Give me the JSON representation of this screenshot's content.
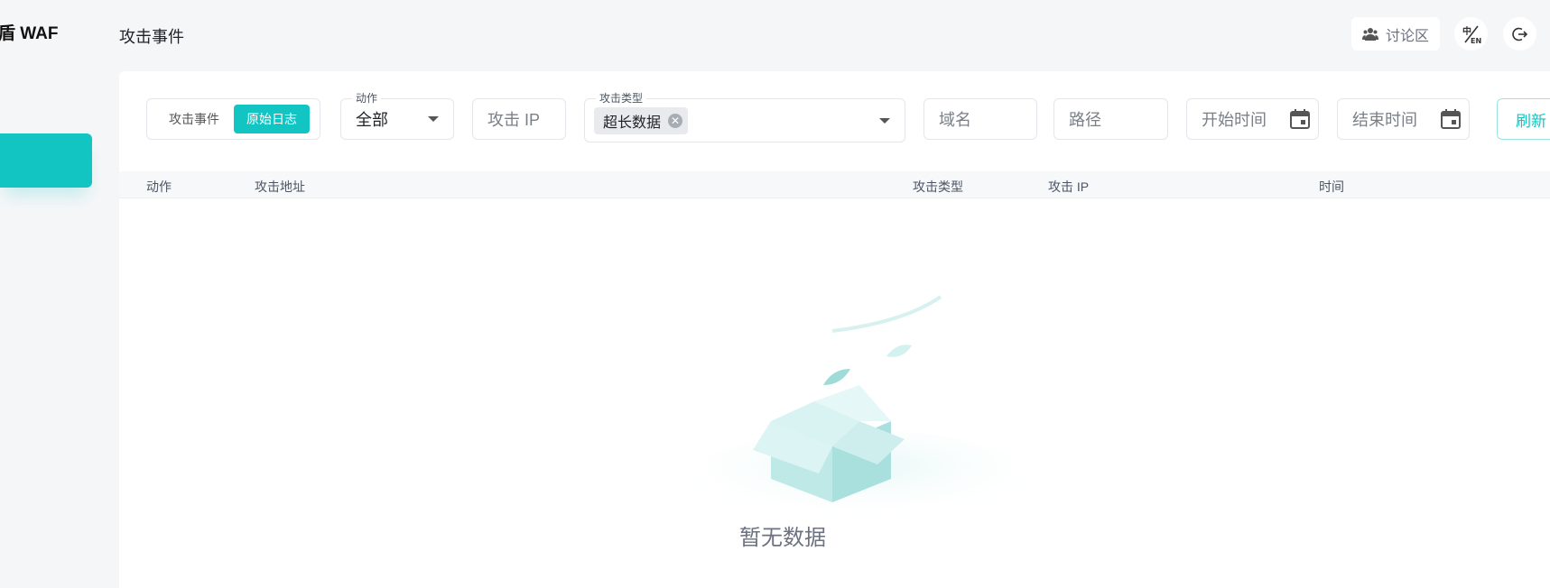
{
  "sidebar": {
    "brand": "盾 WAF"
  },
  "header": {
    "title": "攻击事件",
    "forum_label": "讨论区",
    "lang_icon": "language-toggle-icon",
    "logout_icon": "logout-icon"
  },
  "filters": {
    "mode_tabs": [
      {
        "label": "攻击事件",
        "active": false
      },
      {
        "label": "原始日志",
        "active": true
      }
    ],
    "action": {
      "label": "动作",
      "value": "全部"
    },
    "attack_ip": {
      "placeholder": "攻击 IP"
    },
    "attack_type": {
      "label": "攻击类型",
      "chips": [
        "超长数据"
      ]
    },
    "domain": {
      "placeholder": "域名"
    },
    "path": {
      "placeholder": "路径"
    },
    "start_time": {
      "placeholder": "开始时间"
    },
    "end_time": {
      "placeholder": "结束时间"
    },
    "refresh_label": "刷新"
  },
  "table": {
    "columns": [
      "动作",
      "攻击地址",
      "攻击类型",
      "攻击 IP",
      "时间"
    ],
    "rows": [],
    "empty_text": "暂无数据"
  },
  "colors": {
    "accent": "#12c4c2",
    "background": "#f5f6f8"
  }
}
